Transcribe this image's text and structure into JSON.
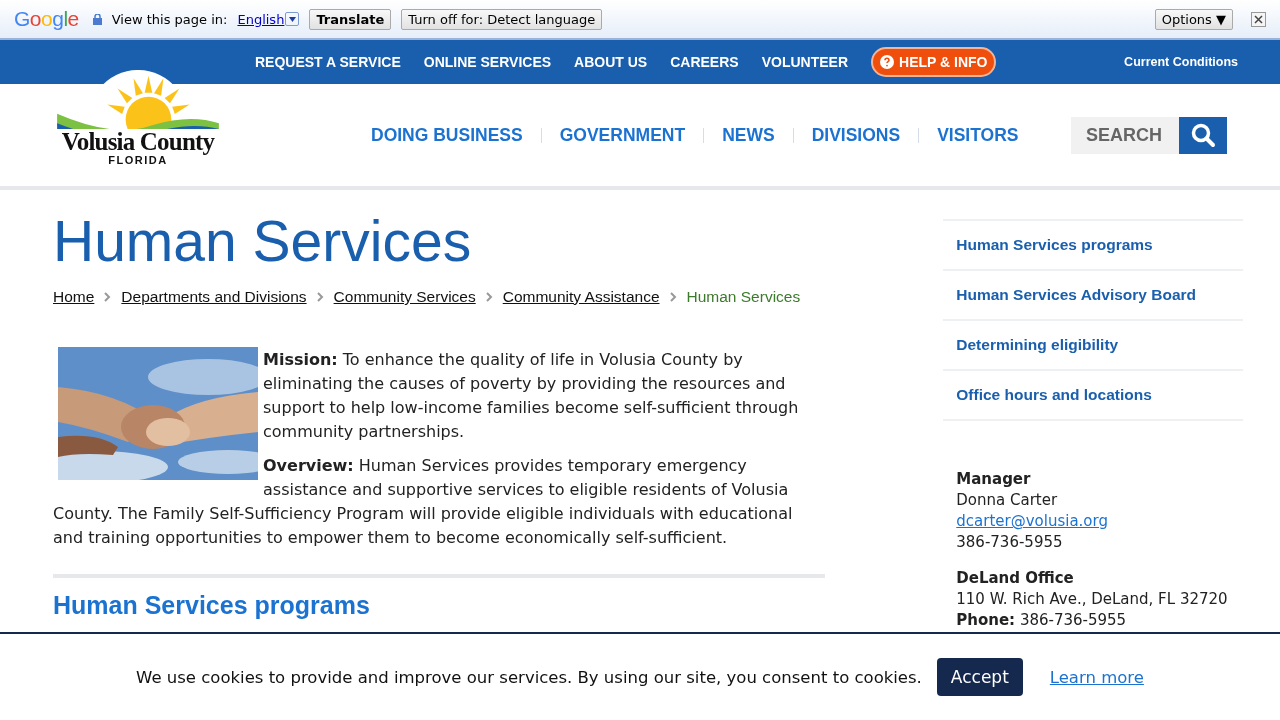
{
  "translate_bar": {
    "brand": "Google",
    "prompt": "View this page in:",
    "language": "English",
    "translate_button": "Translate",
    "turn_off_button": "Turn off for: Detect language",
    "options_button": "Options ▼"
  },
  "top_nav": {
    "items": [
      "REQUEST A SERVICE",
      "ONLINE SERVICES",
      "ABOUT US",
      "CAREERS",
      "VOLUNTEER"
    ],
    "help_button": "HELP & INFO",
    "conditions_link": "Current Conditions"
  },
  "logo": {
    "name": "Volusia County",
    "state": "FLORIDA"
  },
  "main_nav": [
    "DOING BUSINESS",
    "GOVERNMENT",
    "NEWS",
    "DIVISIONS",
    "VISITORS"
  ],
  "search": {
    "placeholder": "SEARCH"
  },
  "page": {
    "title": "Human Services",
    "breadcrumb": [
      {
        "label": "Home",
        "current": false
      },
      {
        "label": "Departments and Divisions",
        "current": false
      },
      {
        "label": "Community Services",
        "current": false
      },
      {
        "label": "Community Assistance",
        "current": false
      },
      {
        "label": "Human Services",
        "current": true
      }
    ],
    "paragraphs": [
      "**Mission:** To enhance the quality of life in Volusia County by eliminating the causes of poverty by providing the resources and support to help low-income families become self-sufficient through community partnerships.",
      "**Overview:**  Human Services provides temporary emergency assistance and supportive services to eligible residents of Volusia County. The Family Self-Sufficiency Program will provide eligible individuals with educational and training opportunities to empower them to become economically self-sufficient."
    ],
    "section_heading": "Human Services programs"
  },
  "sidebar": {
    "links": [
      "Human Services programs",
      "Human Services Advisory Board",
      "Determining eligibility",
      "Office hours and locations"
    ],
    "manager": {
      "heading": "Manager",
      "name": "Donna Carter",
      "email": "dcarter@volusia.org",
      "phone": "386-736-5955"
    },
    "office": {
      "heading": "DeLand Office",
      "address": "110 W. Rich Ave., DeLand, FL 32720",
      "phone_label": "Phone:",
      "phone": "386-736-5955"
    }
  },
  "cookie_banner": {
    "message": "We use cookies to provide and improve our services. By using our site, you consent to cookies.",
    "accept_button": "Accept",
    "learn_more": "Learn more"
  }
}
